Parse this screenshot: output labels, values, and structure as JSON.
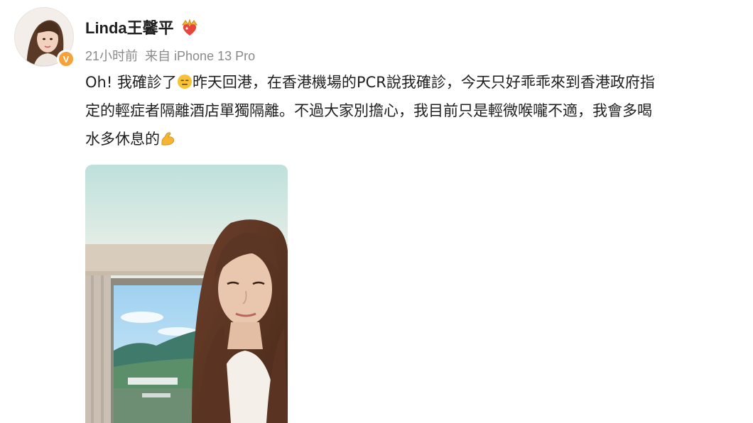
{
  "post": {
    "author": {
      "name": "Linda王馨平",
      "verified_badge_letter": "V"
    },
    "meta": {
      "time": "21小时前",
      "source": "来自 iPhone 13 Pro"
    },
    "text": {
      "line1_a": "Oh! 我確診了",
      "line1_b": "昨天回港，在香港機場的PCR說我確診，今天只好乖乖來到香港政府指",
      "line2": "定的輕症者隔離酒店單獨隔離。不過大家別擔心，我目前只是輕微喉嚨不適，我會多喝",
      "line3": "水多休息的"
    },
    "emojis": {
      "after_name": "crown-heart-icon",
      "line1": "expressionless-face-icon",
      "line3": "flexed-biceps-icon"
    },
    "photo": {
      "subject": "selfie-photo"
    },
    "colors": {
      "badge": "#f6a23b",
      "meta": "#8a8a8a",
      "text": "#1f1f1f"
    }
  }
}
